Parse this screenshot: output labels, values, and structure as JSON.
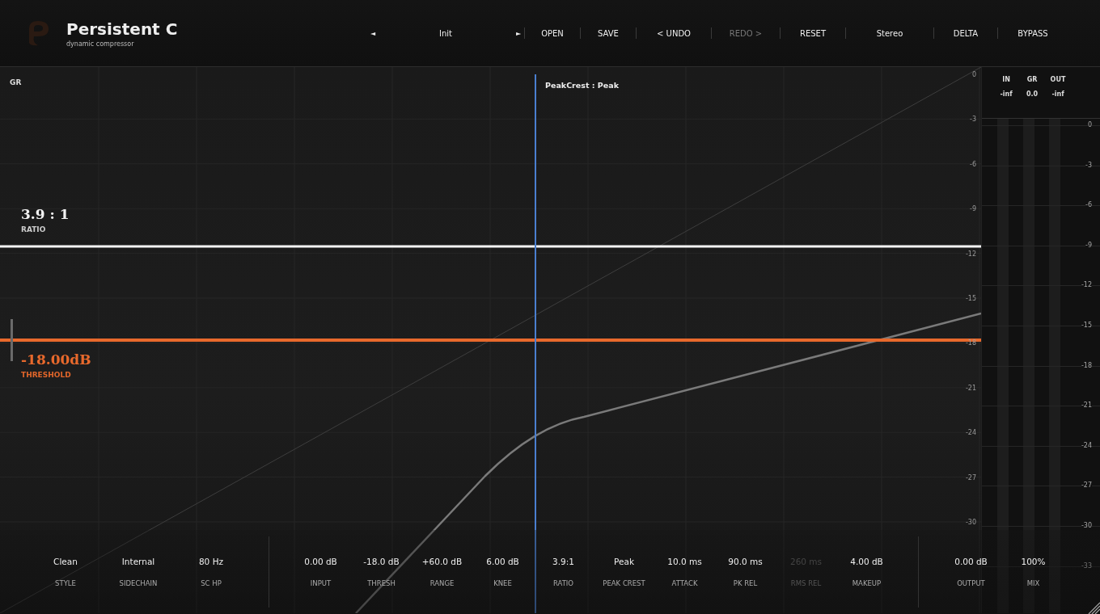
{
  "header": {
    "title": "Persistent C",
    "subtitle": "dynamic compressor",
    "preset": {
      "prev": "◄",
      "name": "Init",
      "next": "►"
    },
    "buttons": [
      {
        "label": "OPEN",
        "disabled": false
      },
      {
        "label": "SAVE",
        "disabled": false
      },
      {
        "label": "< UNDO",
        "disabled": false
      },
      {
        "label": "REDO >",
        "disabled": true
      },
      {
        "label": "RESET",
        "disabled": false
      },
      {
        "label": "Stereo",
        "disabled": false
      },
      {
        "label": "DELTA",
        "disabled": false
      },
      {
        "label": "BYPASS",
        "disabled": false
      }
    ]
  },
  "graph": {
    "axis_label": "GR",
    "detector_label": "PeakCrest : Peak",
    "y_ticks": [
      "0",
      "-3",
      "-6",
      "-9",
      "-12",
      "-15",
      "-18",
      "-21",
      "-24",
      "-27",
      "-30"
    ],
    "ratio": {
      "value": "3.9 : 1",
      "label": "RATIO"
    },
    "threshold": {
      "value": "-18.00dB",
      "label": "THRESHOLD"
    }
  },
  "meters": {
    "channels": [
      {
        "label": "IN",
        "reading": "-inf"
      },
      {
        "label": "GR",
        "reading": "0.0"
      },
      {
        "label": "OUT",
        "reading": "-inf"
      }
    ],
    "scale": [
      "0",
      "-3",
      "-6",
      "-9",
      "-12",
      "-15",
      "-18",
      "-21",
      "-24",
      "-27",
      "-30",
      "-33"
    ]
  },
  "params": [
    [
      {
        "value": "Clean",
        "label": "STYLE",
        "disabled": false
      },
      {
        "value": "Internal",
        "label": "SIDECHAIN",
        "disabled": false
      },
      {
        "value": "80 Hz",
        "label": "SC HP",
        "disabled": false
      }
    ],
    [
      {
        "value": "0.00 dB",
        "label": "INPUT",
        "disabled": false
      },
      {
        "value": "-18.0 dB",
        "label": "THRESH",
        "disabled": false
      },
      {
        "value": "+60.0 dB",
        "label": "RANGE",
        "disabled": false
      },
      {
        "value": "6.00 dB",
        "label": "KNEE",
        "disabled": false
      },
      {
        "value": "3.9:1",
        "label": "RATIO",
        "disabled": false
      },
      {
        "value": "Peak",
        "label": "PEAK CREST",
        "disabled": false
      },
      {
        "value": "10.0 ms",
        "label": "ATTACK",
        "disabled": false
      },
      {
        "value": "90.0 ms",
        "label": "PK REL",
        "disabled": false
      },
      {
        "value": "260 ms",
        "label": "RMS REL",
        "disabled": true
      },
      {
        "value": "4.00 dB",
        "label": "MAKEUP",
        "disabled": false
      }
    ],
    [
      {
        "value": "0.00 dB",
        "label": "OUTPUT",
        "disabled": false
      },
      {
        "value": "100%",
        "label": "MIX",
        "disabled": false
      }
    ]
  ]
}
